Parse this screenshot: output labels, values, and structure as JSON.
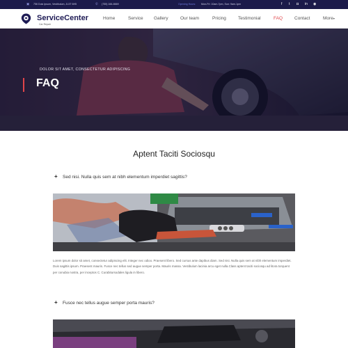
{
  "topbar": {
    "address": "756 Duis Ipsum, Vestibulum, JL5T 6H5",
    "phone": "(755) 166-8669",
    "hours_label": "Opening Hours:",
    "hours": "Mon-Fri: 10am-7pm, Sun: 9am-1pm",
    "social_icons": [
      "facebook-icon",
      "twitter-icon",
      "instagram-icon",
      "linkedin-icon",
      "dribbble-icon"
    ]
  },
  "header": {
    "brand": "ServiceCenter",
    "tagline": "Car Repair",
    "nav": [
      {
        "label": "Home"
      },
      {
        "label": "Service"
      },
      {
        "label": "Gallery"
      },
      {
        "label": "Our team"
      },
      {
        "label": "Pricing"
      },
      {
        "label": "Testimonial"
      },
      {
        "label": "FAQ",
        "active": true
      },
      {
        "label": "Contact"
      },
      {
        "label": "More",
        "caret": "▾"
      }
    ]
  },
  "hero": {
    "kicker": "DOLOR SIT AMET, CONSECTETUR ADIPISCING",
    "title": "FAQ"
  },
  "section": {
    "title": "Aptent Taciti Sociosqu",
    "faqs": [
      {
        "question": "Sed nisi. Nulla quis sem at nibh elementum imperdiet sagittis?",
        "answer": "Lorem ipsum dolor sit amet, consectetur adipiscing elit. Integer nec odioo. Praesent libero. Sed cursus ante dapibus diam. Sed nisi. Nulla quis sem at nibh elementum imperdiet. Duis sagittis ipsum. Praesent mauris. Fusce nec tellus sed augue semper porta. Mauris massa. Vestibulum lacinia arcu eget nulla.Class aptent taciti sociosqu ad litora torquent per conubia nostra, per inceptos C. Curabitursodales ligula in libero."
      },
      {
        "question": "Fusce nec tellus augue semper porta mauris?"
      }
    ]
  },
  "colors": {
    "topbar_bg": "#1b1a4a",
    "brand": "#1e1b55",
    "accent": "#e0454a"
  }
}
